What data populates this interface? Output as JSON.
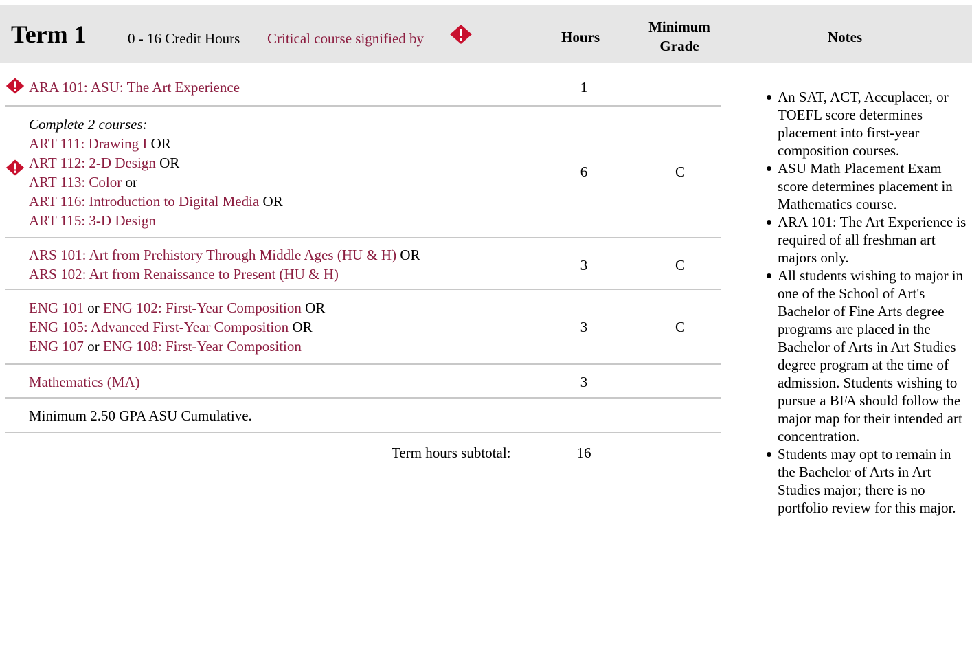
{
  "header": {
    "term": "Term 1",
    "credit_hours": "0 - 16 Credit Hours",
    "critical_text": "Critical course signified by",
    "critical_icon": "critical-icon",
    "columns": {
      "hours": "Hours",
      "min_grade": "Minimum Grade",
      "notes": "Notes"
    }
  },
  "rows": [
    {
      "critical": true,
      "lines": [
        [
          {
            "t": "ARA 101: ASU: The Art Experience",
            "link": true
          }
        ]
      ],
      "hours": "1",
      "grade": ""
    },
    {
      "critical": true,
      "heading": "Complete 2 courses:",
      "lines": [
        [
          {
            "t": "ART 111: Drawing I",
            "link": true
          },
          {
            "t": " OR"
          }
        ],
        [
          {
            "t": "ART 112: 2-D Design",
            "link": true
          },
          {
            "t": " OR"
          }
        ],
        [
          {
            "t": "ART 113: Color",
            "link": true
          },
          {
            "t": " or"
          }
        ],
        [
          {
            "t": "ART 116: Introduction to Digital Media",
            "link": true
          },
          {
            "t": " OR"
          }
        ],
        [
          {
            "t": "ART 115: 3-D Design",
            "link": true
          }
        ]
      ],
      "hours": "6",
      "grade": "C"
    },
    {
      "critical": false,
      "lines": [
        [
          {
            "t": "ARS 101: Art from Prehistory Through Middle Ages (HU & H)",
            "link": true
          },
          {
            "t": " OR"
          }
        ],
        [
          {
            "t": "ARS 102: Art from Renaissance to Present (HU & H)",
            "link": true
          }
        ]
      ],
      "hours": "3",
      "grade": "C"
    },
    {
      "critical": false,
      "lines": [
        [
          {
            "t": "ENG 101",
            "link": true
          },
          {
            "t": " or "
          },
          {
            "t": "ENG 102: First-Year Composition",
            "link": true
          },
          {
            "t": " OR"
          }
        ],
        [
          {
            "t": "ENG 105: Advanced First-Year Composition",
            "link": true
          },
          {
            "t": " OR"
          }
        ],
        [
          {
            "t": "ENG 107",
            "link": true
          },
          {
            "t": " or "
          },
          {
            "t": "ENG 108: First-Year Composition",
            "link": true
          }
        ]
      ],
      "hours": "3",
      "grade": "C"
    },
    {
      "critical": false,
      "lines": [
        [
          {
            "t": "Mathematics (MA)",
            "link": true
          }
        ]
      ],
      "hours": "3",
      "grade": ""
    },
    {
      "critical": false,
      "lines": [
        [
          {
            "t": "Minimum 2.50 GPA ASU Cumulative."
          }
        ]
      ],
      "hours": "",
      "grade": ""
    }
  ],
  "subtotal": {
    "label": "Term hours subtotal:",
    "value": "16"
  },
  "notes": [
    "An SAT, ACT, Accuplacer, or TOEFL score determines placement into first-year composition courses.",
    "ASU Math Placement Exam score determines placement in Mathematics course.",
    "ARA 101: The Art Experience is required of all freshman art majors only.",
    "All students wishing to major in one of the School of Art's Bachelor of Fine Arts degree programs are placed in the Bachelor of Arts in Art Studies degree program at the time of admission. Students wishing to pursue a BFA should follow the major map for their intended art concentration.",
    "Students may opt to remain in the Bachelor of Arts in Art Studies major; there is no portfolio review for this major."
  ],
  "colors": {
    "link": "#8c1d40",
    "header_bg": "#e6e6e6",
    "critical": "#c8102e"
  }
}
